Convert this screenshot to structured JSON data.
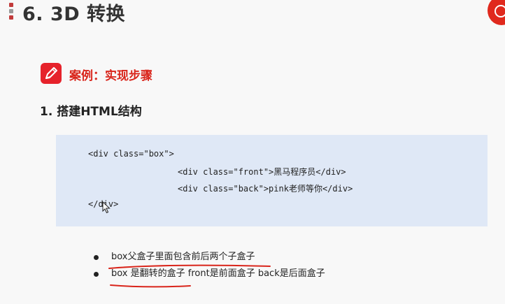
{
  "page": {
    "title": "6. 3D 转换"
  },
  "case": {
    "icon": "pencil-icon",
    "title": "案例：实现步骤"
  },
  "step": {
    "heading": "1. 搭建HTML结构"
  },
  "code": {
    "lines": [
      "<div class=\"box\">",
      "<div class=\"front\">黑马程序员</div>",
      "<div class=\"back\">pink老师等你</div>",
      "</div>"
    ]
  },
  "bullets": [
    {
      "text": "box父盒子里面包含前后两个子盒子"
    },
    {
      "text": "box 是翻转的盒子  front是前面盒子 back是后面盒子"
    }
  ],
  "colors": {
    "accent": "#e6222b",
    "code_bg": "#dfe8f6",
    "underline": "#d9251b"
  }
}
